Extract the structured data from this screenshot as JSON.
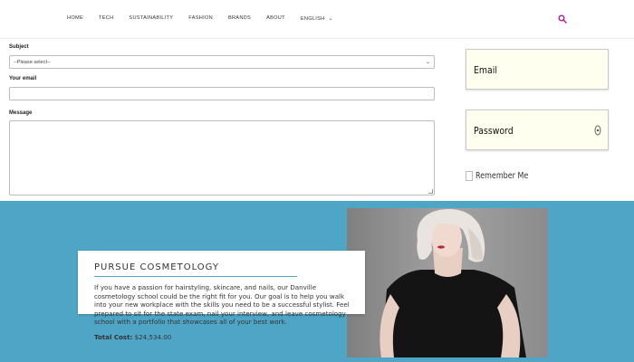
{
  "nav": {
    "items": [
      "HOME",
      "TECH",
      "SUSTAINABILITY",
      "FASHION",
      "BRANDS",
      "ABOUT"
    ],
    "language": "ENGLISH",
    "search_icon": "search-icon",
    "accent": "#b5179e"
  },
  "form": {
    "subject_label": "Subject",
    "subject_selected": "--Please select--",
    "email_label": "Your email",
    "message_label": "Message"
  },
  "login": {
    "email_label": "Email",
    "password_label": "Password",
    "remember_label": "Remember Me"
  },
  "promo": {
    "title": "PURSUE COSMETOLOGY",
    "body": "If you have a passion for hairstyling, skincare, and nails, our Danville cosmetology school could be the right fit for you. Our goal is to help you walk into your new workplace with the skills you need to be a successful stylist. Feel prepared to sit for the state exam, nail your interview, and leave cosmetology school with a portfolio that showcases all of your best work.",
    "cost_label": "Total Cost:",
    "cost_value": "$24,534.00",
    "band_color": "#4ea5c6"
  }
}
